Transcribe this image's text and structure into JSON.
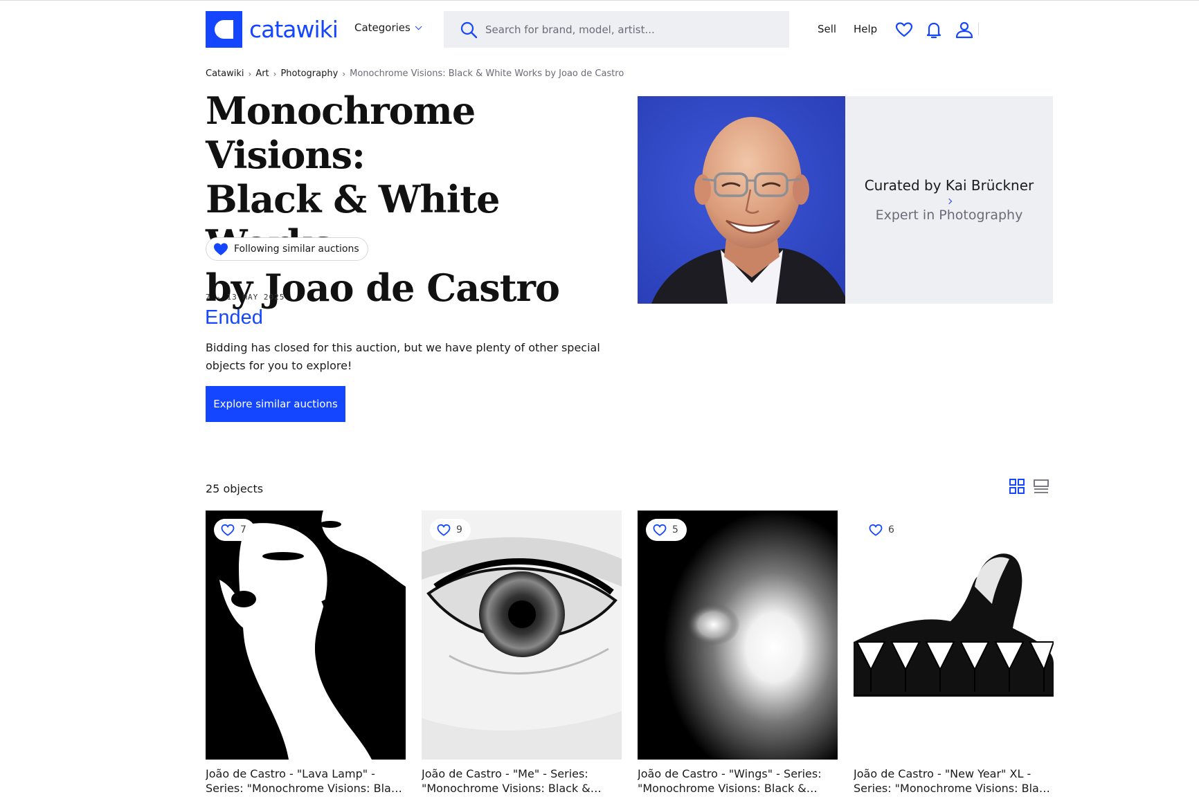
{
  "header": {
    "logo_text": "catawiki",
    "categories_label": "Categories",
    "search_placeholder": "Search for brand, model, artist...",
    "sell_label": "Sell",
    "help_label": "Help",
    "icons": [
      "search-icon",
      "heart-icon",
      "bell-icon",
      "user-icon"
    ]
  },
  "breadcrumb": [
    {
      "label": "Catawiki"
    },
    {
      "label": "Art"
    },
    {
      "label": "Photography"
    },
    {
      "label": "Monochrome Visions: Black & White Works by Joao de Castro"
    }
  ],
  "auction": {
    "title_line1": "Monochrome Visions:",
    "title_line2": "Black & White Works",
    "title_line3": "by Joao de Castro",
    "follow_label": "Following similar auctions",
    "date_range": "7 - 13 MAY 2025",
    "status": "Ended",
    "description": "Bidding has closed for this auction, but we have plenty of other special objects for you to explore!",
    "explore_label": "Explore similar auctions"
  },
  "curator": {
    "name": "Curated by Kai Brückner",
    "role": "Expert in Photography"
  },
  "objects": {
    "count_label": "25 objects",
    "items": [
      {
        "favorites": "7",
        "title": "João de Castro - \"Lava Lamp\" - Series: \"Monochrome Visions: Black & White Works\""
      },
      {
        "favorites": "9",
        "title": "João de Castro - \"Me\" - Series: \"Monochrome Visions: Black & White Works\""
      },
      {
        "favorites": "5",
        "title": "João de Castro - \"Wings\" - Series: \"Monochrome Visions: Black & White Works\""
      },
      {
        "favorites": "6",
        "title": "João de Castro - \"New Year\" XL - Series: \"Monochrome Visions: Black & White Works\""
      }
    ]
  },
  "colors": {
    "brand_blue": "#1546ff",
    "panel_gray": "#eeeff2",
    "muted_text": "#6b6b78"
  }
}
